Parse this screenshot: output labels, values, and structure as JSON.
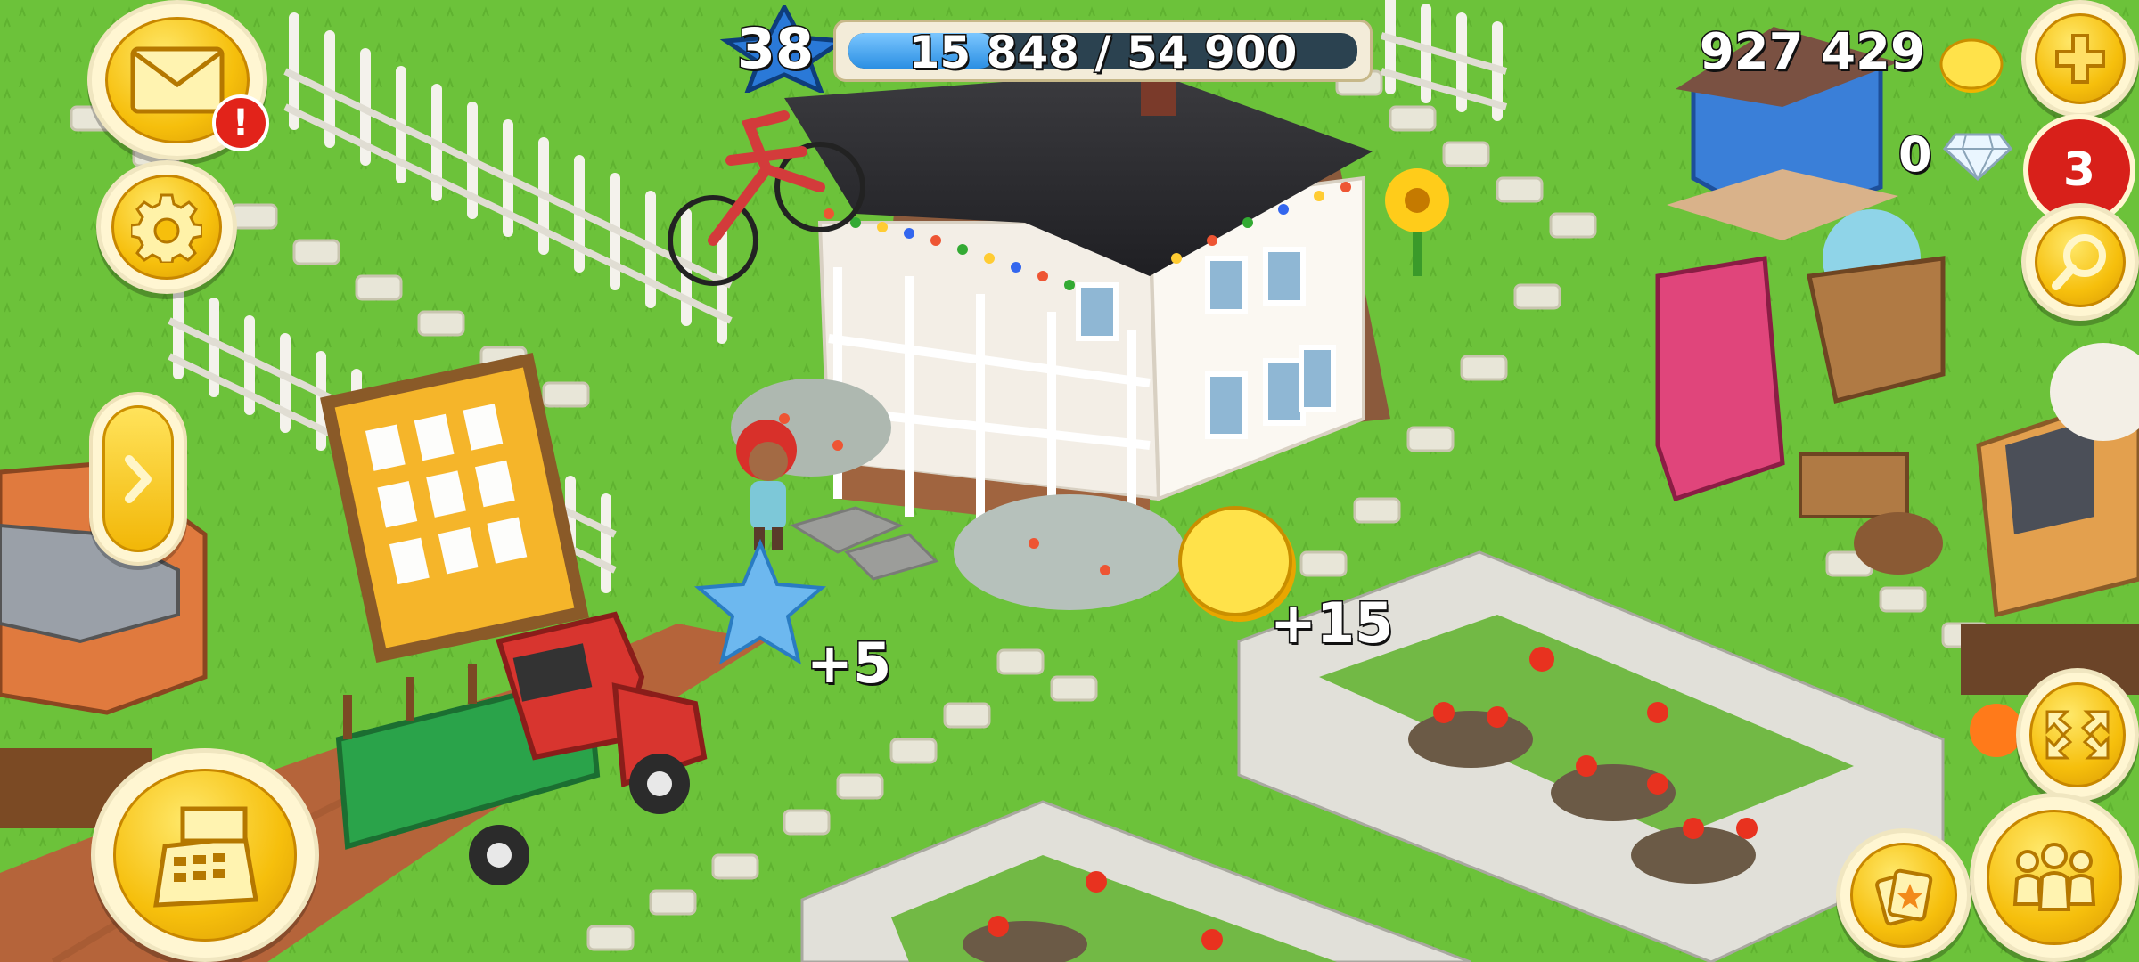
{
  "hud": {
    "level": "38",
    "xp_text": "15 848 / 54 900",
    "xp_fraction": 0.2887,
    "coins": "927 429",
    "diamonds": "0",
    "notification_count": "3",
    "mail_alert": "!"
  },
  "rewards": {
    "xp_gain": "+5",
    "coin_gain": "+15"
  },
  "colors": {
    "grass": "#6cc23a",
    "button_yellow": "#f6bf0c",
    "badge_red": "#e2231a",
    "xp_blue": "#2b8fe3"
  },
  "icons": {
    "mail": "envelope-icon",
    "settings": "gear-icon",
    "side_panel": "chevron-right-icon",
    "shop": "cash-register-icon",
    "add_coins": "plus-icon",
    "search": "magnifier-icon",
    "edit": "expand-arrows-icon",
    "friends": "people-icon",
    "cards": "cards-icon"
  }
}
